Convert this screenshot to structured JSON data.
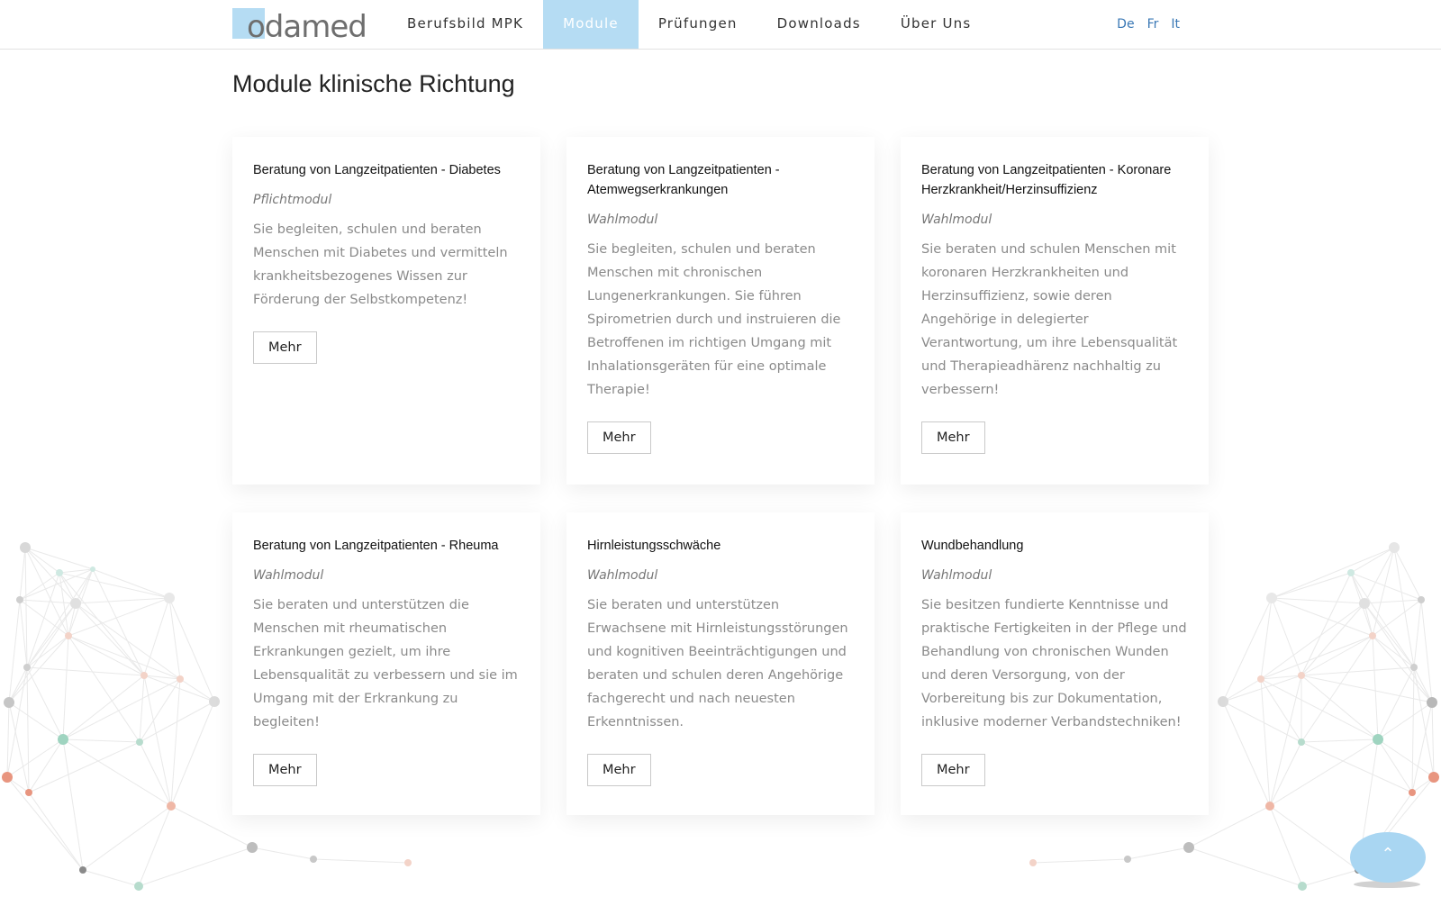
{
  "header": {
    "logo_text": "odamed",
    "nav": [
      {
        "label": "Berufsbild MPK",
        "active": false
      },
      {
        "label": "Module",
        "active": true
      },
      {
        "label": "Prüfungen",
        "active": false
      },
      {
        "label": "Downloads",
        "active": false
      },
      {
        "label": "Über Uns",
        "active": false
      }
    ],
    "languages": [
      "De",
      "Fr",
      "It"
    ]
  },
  "page_title": "Module klinische Richtung",
  "modules": [
    {
      "title": "Beratung von Langzeitpatienten - Diabetes",
      "type": "Pflichtmodul",
      "description": "Sie begleiten, schulen und beraten Menschen mit Diabetes und vermitteln krankheitsbezogenes Wissen zur Förderung der Selbstkompetenz!",
      "button": "Mehr"
    },
    {
      "title": "Beratung von Langzeitpatienten - Atemwegserkrankungen",
      "type": "Wahlmodul",
      "description": "Sie begleiten, schulen und beraten Menschen mit chronischen Lungenerkrankungen. Sie führen Spirometrien durch und instruieren die Betroffenen im richtigen Umgang mit Inhalationsgeräten für eine optimale Therapie!",
      "button": "Mehr"
    },
    {
      "title": "Beratung von Langzeitpatienten - Koronare Herzkrankheit/Herzinsuffizienz",
      "type": "Wahlmodul",
      "description": "Sie beraten und schulen Menschen mit koronaren Herzkrankheiten und Herzinsuffizienz, sowie deren Angehörige in delegierter Verantwortung, um ihre Lebensqualität und Therapieadhärenz nachhaltig zu verbessern!",
      "button": "Mehr"
    },
    {
      "title": "Beratung von Langzeitpatienten - Rheuma",
      "type": "Wahlmodul",
      "description": "Sie beraten und unterstützen die Menschen mit rheumatischen Erkrankungen gezielt, um ihre Lebensqualität zu verbessern und sie im Umgang mit der Erkrankung zu begleiten!",
      "button": "Mehr"
    },
    {
      "title": "Hirnleistungsschwäche",
      "type": "Wahlmodul",
      "description": "Sie beraten und unterstützen Erwachsene mit Hirnleistungsstörungen und kognitiven Beeinträchtigungen und beraten und schulen deren Angehörige fachgerecht und nach neuesten Erkenntnissen.",
      "button": "Mehr"
    },
    {
      "title": "Wundbehandlung",
      "type": "Wahlmodul",
      "description": "Sie besitzen fundierte Kenntnisse und praktische Fertigkeiten in der Pflege und Behandlung von chronischen Wunden und deren Versorgung, von der Vorbereitung bis zur Dokumentation, inklusive moderner Verbandstechniken!",
      "button": "Mehr"
    }
  ],
  "scroll_top_icon": "chevron-up-icon",
  "colors": {
    "accent": "#b5dcf3",
    "link": "#3a78b5",
    "scroll_button": "#a9d6f2"
  }
}
